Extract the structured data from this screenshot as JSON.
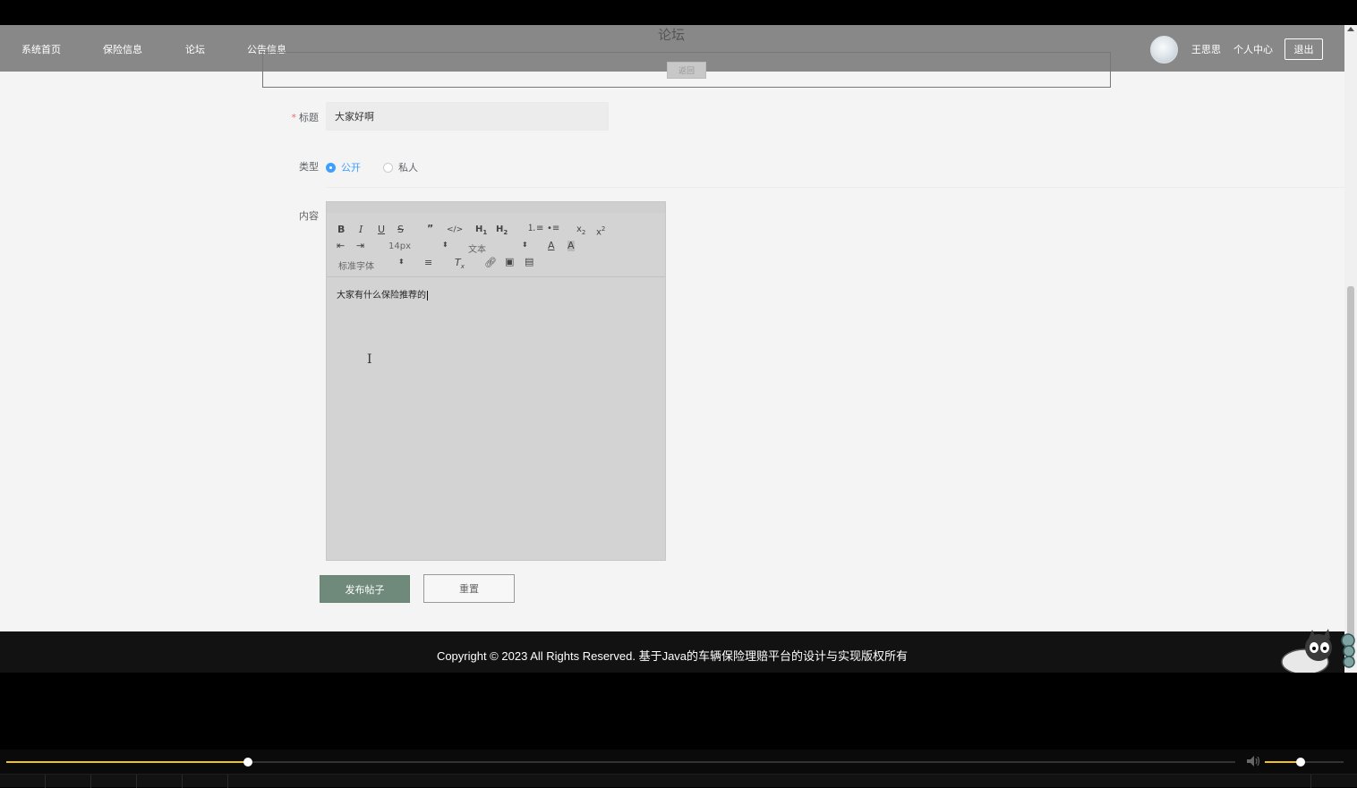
{
  "nav": {
    "items": [
      {
        "label": "系统首页"
      },
      {
        "label": "保险信息"
      },
      {
        "label": "论坛"
      },
      {
        "label": "公告信息"
      }
    ],
    "username": "王思思",
    "profile_label": "个人中心",
    "logout_label": "退出"
  },
  "page": {
    "title": "论坛",
    "back_label": "返回"
  },
  "form": {
    "title_label": "标题",
    "title_value": "大家好啊",
    "type_label": "类型",
    "type_options": [
      {
        "label": "公开",
        "selected": true
      },
      {
        "label": "私人",
        "selected": false
      }
    ],
    "content_label": "内容",
    "editor": {
      "font_size": "14px",
      "header_select": "文本",
      "font_family": "标准字体",
      "content": "大家有什么保险推荐的"
    },
    "submit_label": "发布帖子",
    "reset_label": "重置"
  },
  "footer": {
    "copyright": "Copyright © 2023 All Rights Reserved. 基于Java的车辆保险理赔平台的设计与实现版权所有"
  },
  "player": {
    "progress_fraction": 0.197,
    "volume_fraction": 0.45,
    "accent_color": "#f2c21d"
  },
  "colors": {
    "primary": "#409eff",
    "submit": "#6f8a7b",
    "required": "#f56c6c"
  }
}
